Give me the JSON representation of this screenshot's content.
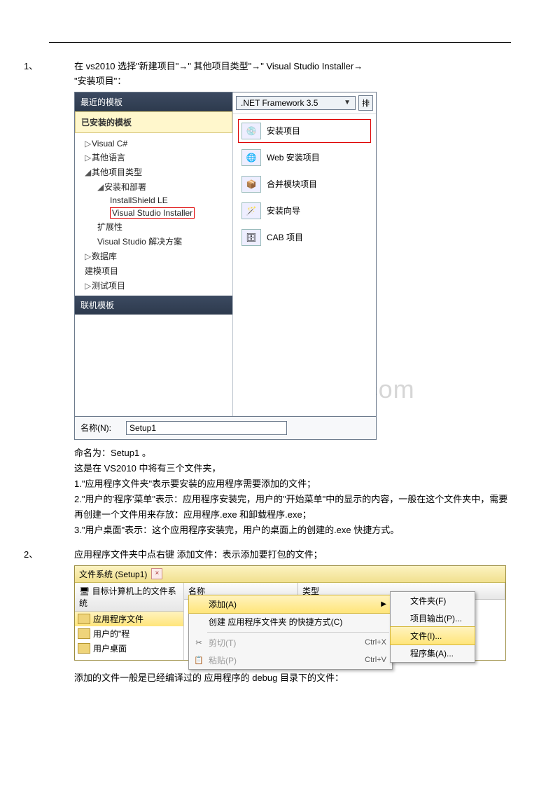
{
  "watermark": "www.weizhuannet.com",
  "step1": {
    "num": "1、",
    "text_a": "在 vs2010 选择\"新建项目\"",
    "arrow": "→",
    "text_b": "\" 其他项目类型\"",
    "text_c": "\" Visual Studio Installer",
    "text_d": "\"安装项目\"："
  },
  "dialog1": {
    "left": {
      "recent_header": "最近的模板",
      "installed_header": "已安装的模板",
      "tree": {
        "csharp": "Visual C#",
        "otherlang": "其他语言",
        "othertypes": "其他项目类型",
        "setup_deploy": "安装和部署",
        "installshield": "InstallShield LE",
        "vsinstaller": "Visual Studio Installer",
        "ext": "扩展性",
        "vs_solution": "Visual Studio 解决方案",
        "database": "数据库",
        "modeling": "建模项目",
        "test": "测试项目"
      },
      "online_header": "联机模板"
    },
    "right": {
      "framework": ".NET Framework 3.5",
      "sort": "排",
      "templates": {
        "t0": "安装项目",
        "t1": "Web 安装项目",
        "t2": "合并模块项目",
        "t3": "安装向导",
        "t4": "CAB 项目"
      }
    },
    "name_label": "名称(N):",
    "name_value": "Setup1"
  },
  "body1": {
    "l1": "命名为：Setup1 。",
    "l2": "这是在 VS2010 中将有三个文件夹，",
    "l3": "1.\"应用程序文件夹\"表示要安装的应用程序需要添加的文件；",
    "l4": "2.\"用户的'程序'菜单\"表示：应用程序安装完，用户的\"开始菜单\"中的显示的内容，一般在这个文件夹中，需要再创建一个文件用来存放：应用程序.exe 和卸载程序.exe；",
    "l5": "3.\"用户桌面\"表示：这个应用程序安装完，用户的桌面上的创建的.exe 快捷方式。"
  },
  "step2": {
    "num": "2、",
    "text": "应用程序文件夹中点右键 添加文件：表示添加要打包的文件；"
  },
  "dialog2": {
    "title": "文件系统 (Setup1)",
    "close": "×",
    "tree_header": "目标计算机上的文件系统",
    "tree": {
      "app_folder": "应用程序文件",
      "user_menu": "用户的\"程",
      "user_desktop": "用户桌面"
    },
    "list_headers": {
      "name": "名称",
      "type": "类型"
    },
    "context": {
      "add": "添加(A)",
      "create_shortcut": "创建 应用程序文件夹 的快捷方式(C)",
      "cut": "剪切(T)",
      "cut_sc": "Ctrl+X",
      "paste": "粘贴(P)",
      "paste_sc": "Ctrl+V"
    },
    "submenu": {
      "folder": "文件夹(F)",
      "output": "项目输出(P)...",
      "file": "文件(I)...",
      "assembly": "程序集(A)..."
    }
  },
  "body2": {
    "l1": "添加的文件一般是已经编译过的 应用程序的 debug 目录下的文件："
  }
}
